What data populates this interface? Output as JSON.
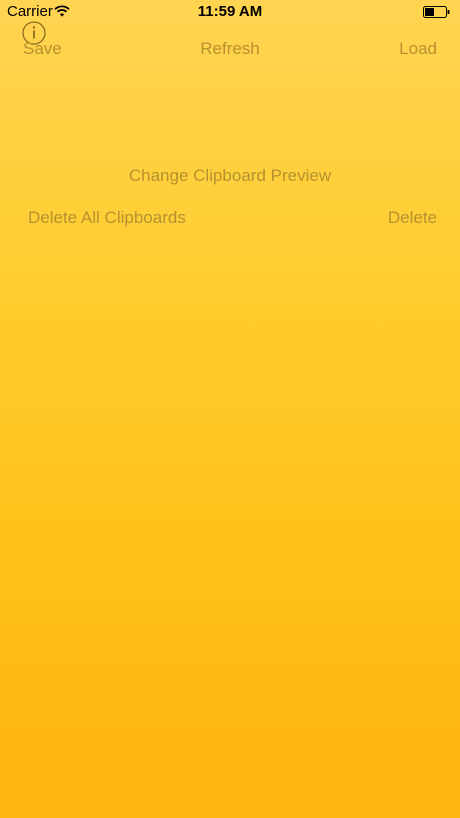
{
  "status_bar": {
    "carrier": "Carrier",
    "time": "11:59 AM",
    "wifi_icon": "wifi-icon",
    "battery_icon": "battery-icon"
  },
  "toolbar": {
    "info_icon": "info-icon",
    "save_label": "Save",
    "refresh_label": "Refresh",
    "load_label": "Load"
  },
  "main": {
    "change_preview_label": "Change Clipboard Preview",
    "delete_all_label": "Delete All Clipboards",
    "delete_label": "Delete"
  },
  "colors": {
    "background_top": "#ffd452",
    "background_bottom": "#ffb40f",
    "button_text": "#b6922f",
    "icon": "#8a6d1c"
  }
}
